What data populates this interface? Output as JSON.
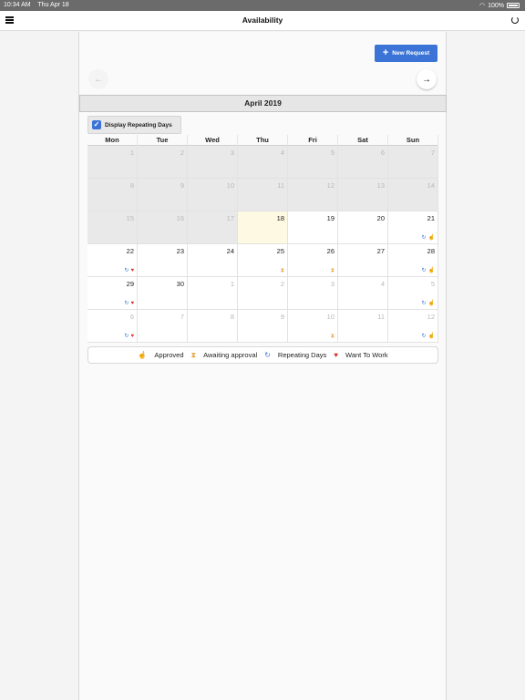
{
  "status": {
    "time": "10:34 AM",
    "date": "Thu Apr 18",
    "battery": "100%"
  },
  "nav": {
    "title": "Availability"
  },
  "toolbar": {
    "new_request_label": "New Request"
  },
  "calendar": {
    "month_label": "April 2019",
    "repeat_label": "Display Repeating Days",
    "weekdays": [
      "Mon",
      "Tue",
      "Wed",
      "Thu",
      "Fri",
      "Sat",
      "Sun"
    ],
    "days": [
      {
        "n": "1",
        "past": true
      },
      {
        "n": "2",
        "past": true
      },
      {
        "n": "3",
        "past": true
      },
      {
        "n": "4",
        "past": true
      },
      {
        "n": "5",
        "past": true
      },
      {
        "n": "6",
        "past": true
      },
      {
        "n": "7",
        "past": true
      },
      {
        "n": "8",
        "past": true
      },
      {
        "n": "9",
        "past": true
      },
      {
        "n": "10",
        "past": true
      },
      {
        "n": "11",
        "past": true
      },
      {
        "n": "12",
        "past": true
      },
      {
        "n": "13",
        "past": true
      },
      {
        "n": "14",
        "past": true
      },
      {
        "n": "15",
        "past": true
      },
      {
        "n": "16",
        "past": true
      },
      {
        "n": "17",
        "past": true
      },
      {
        "n": "18",
        "today": true
      },
      {
        "n": "19"
      },
      {
        "n": "20"
      },
      {
        "n": "21",
        "icons": [
          "repeat",
          "approved"
        ]
      },
      {
        "n": "22",
        "icons": [
          "repeat",
          "heart"
        ]
      },
      {
        "n": "23"
      },
      {
        "n": "24"
      },
      {
        "n": "25",
        "icons": [
          "hourglass"
        ]
      },
      {
        "n": "26",
        "icons": [
          "hourglass"
        ]
      },
      {
        "n": "27"
      },
      {
        "n": "28",
        "icons": [
          "repeat",
          "approved"
        ]
      },
      {
        "n": "29",
        "icons": [
          "repeat",
          "heart"
        ]
      },
      {
        "n": "30"
      },
      {
        "n": "1",
        "other": true
      },
      {
        "n": "2",
        "other": true
      },
      {
        "n": "3",
        "other": true
      },
      {
        "n": "4",
        "other": true
      },
      {
        "n": "5",
        "other": true,
        "icons": [
          "repeat",
          "approved"
        ]
      },
      {
        "n": "6",
        "other": true,
        "icons": [
          "repeat",
          "heart"
        ]
      },
      {
        "n": "7",
        "other": true
      },
      {
        "n": "8",
        "other": true
      },
      {
        "n": "9",
        "other": true
      },
      {
        "n": "10",
        "other": true,
        "icons": [
          "hourglass"
        ]
      },
      {
        "n": "11",
        "other": true
      },
      {
        "n": "12",
        "other": true,
        "icons": [
          "repeat",
          "approved"
        ]
      }
    ]
  },
  "legend": [
    {
      "icon": "approved",
      "label": "Approved"
    },
    {
      "icon": "hourglass",
      "label": "Awaiting approval"
    },
    {
      "icon": "repeat",
      "label": "Repeating Days"
    },
    {
      "icon": "heart",
      "label": "Want To Work"
    }
  ],
  "colors": {
    "accent": "#3b74d6",
    "approved": "#8bc34a",
    "awaiting": "#e6a23c",
    "want": "#d93025",
    "today": "#fdf9e3"
  }
}
